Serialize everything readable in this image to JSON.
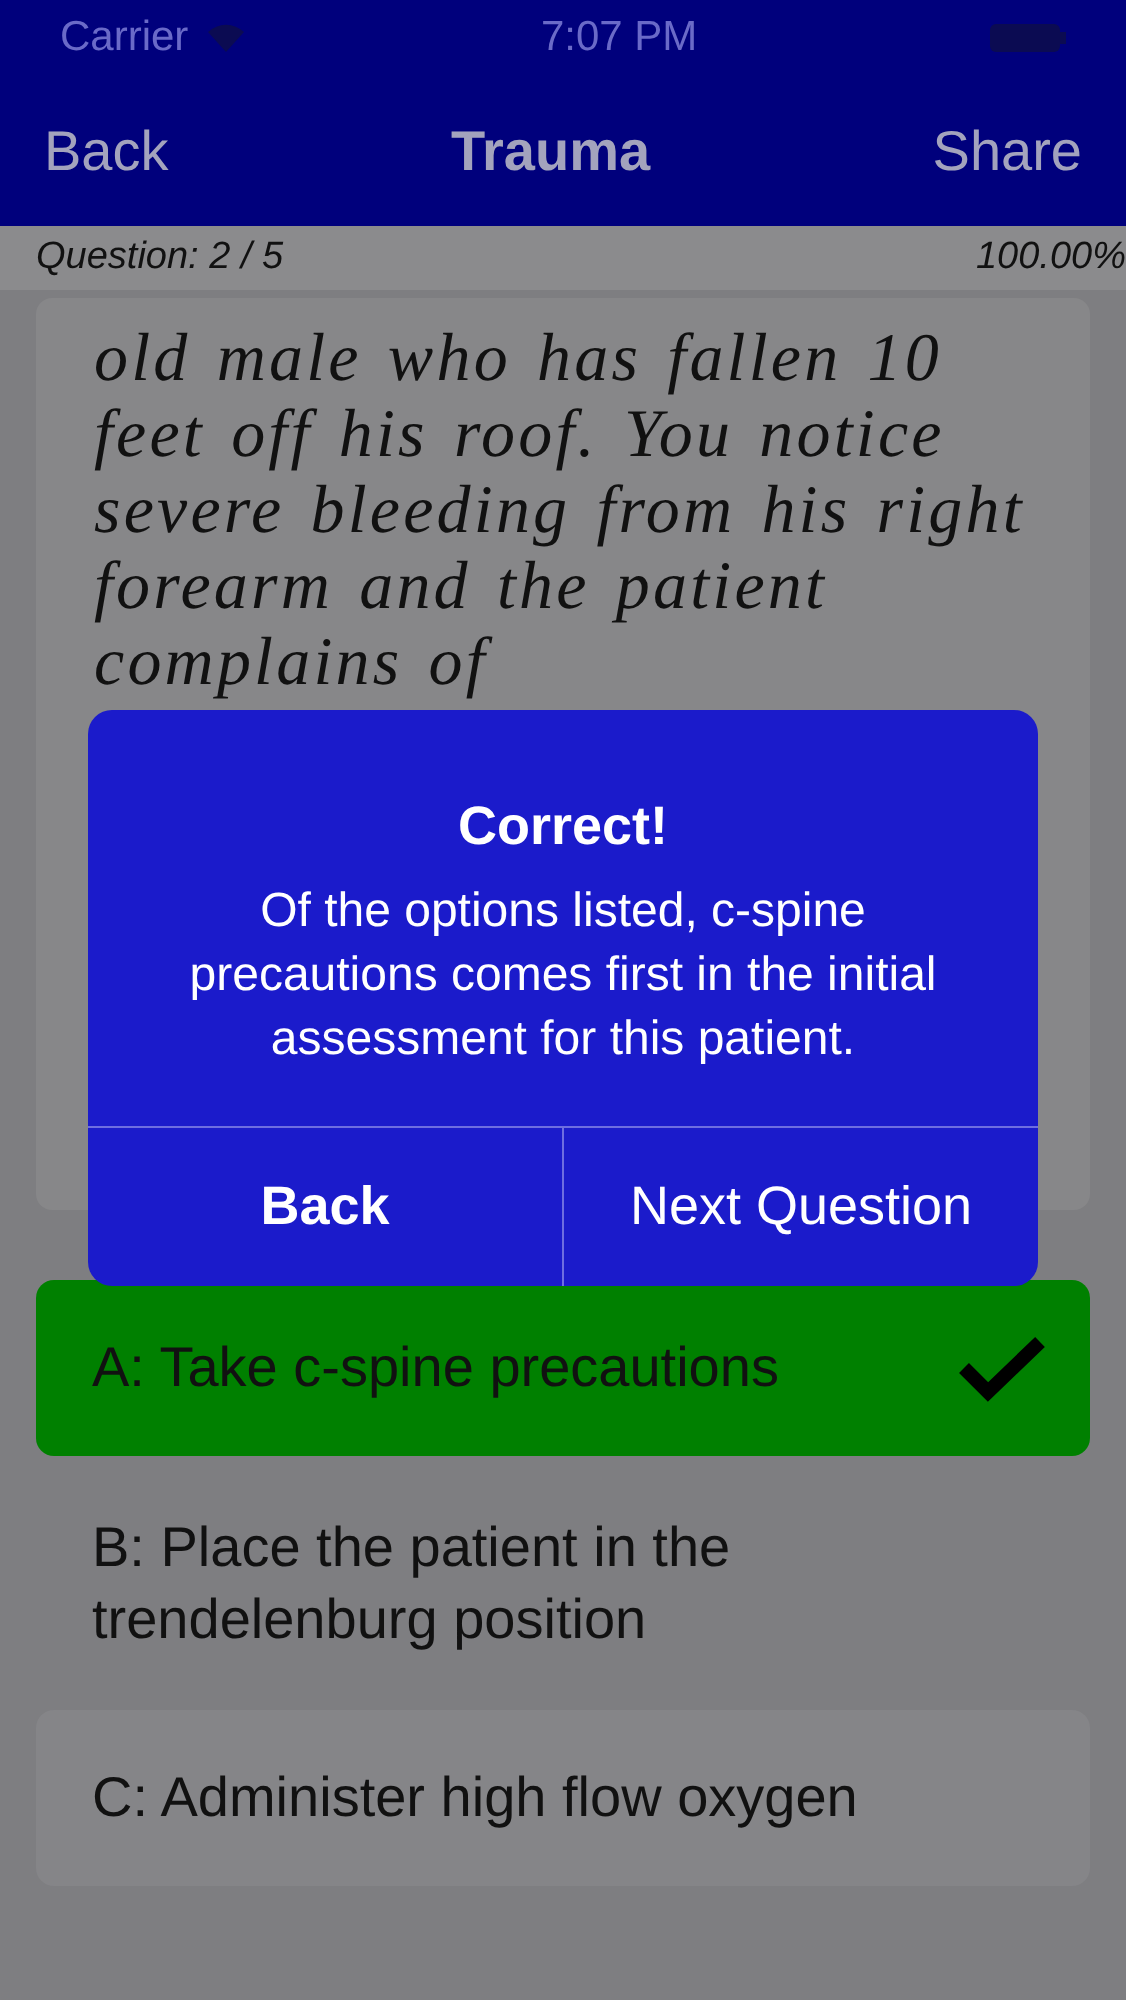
{
  "status_bar": {
    "carrier": "Carrier",
    "time": "7:07 PM"
  },
  "nav": {
    "back": "Back",
    "title": "Trauma",
    "share": "Share"
  },
  "progress": {
    "question": "Question: 2 / 5",
    "score": "100.00%"
  },
  "question": {
    "text": "old male who has fallen 10 feet off his roof. You notice severe bleeding from his right forearm and the patient complains of"
  },
  "alert": {
    "title": "Correct!",
    "message": "Of the options listed, c-spine precautions comes first in the initial assessment for this patient.",
    "buttons": [
      "Back",
      "Next Question"
    ]
  },
  "answers": [
    {
      "label": "A: Take c-spine precautions",
      "correct": true
    },
    {
      "label": "B: Place the patient in the trendelenburg position",
      "correct": false
    },
    {
      "label": "C: Administer high flow oxygen",
      "correct": false
    }
  ]
}
